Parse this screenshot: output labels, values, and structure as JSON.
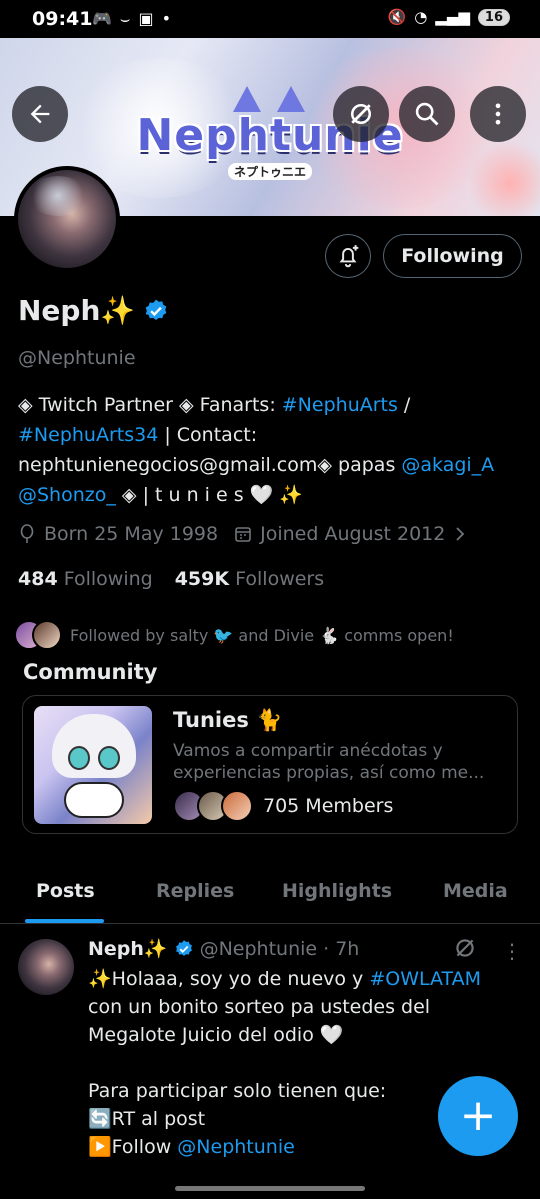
{
  "status_bar": {
    "time": "09:41",
    "battery": "16"
  },
  "banner": {
    "logo_text": "Nephtunie",
    "logo_subtext": "ネプトゥニエ"
  },
  "profile": {
    "name": "Neph✨",
    "handle": "@Nephtunie",
    "following_button": "Following",
    "bio": {
      "p1": "◈ Twitch Partner ◈ Fanarts: ",
      "tag1": "#NephuArts",
      "p2": " /",
      "tag2": "#NephuArts34",
      "p3": " | Contact: nephtunienegocios@gmail.com◈ papas ",
      "mention1": "@akagi_A",
      "p4": " ",
      "mention2": "@Shonzo_",
      "p5": " ◈ | t u n i e s 🤍 ✨"
    },
    "born": "Born 25 May 1998",
    "joined": "Joined August 2012",
    "following_count": "484",
    "following_label": "Following",
    "followers_count": "459K",
    "followers_label": "Followers",
    "followed_by": "Followed by salty 🐦 and Divie 🐇 comms open!"
  },
  "community": {
    "section_title": "Community",
    "name": "Tunies 🐈",
    "description": "Vamos a compartir anécdotas y experiencias propias, así como me...",
    "members": "705 Members"
  },
  "tabs": [
    "Posts",
    "Replies",
    "Highlights",
    "Media"
  ],
  "post": {
    "name": "Neph✨",
    "handle_time": "@Nephtunie · 7h",
    "line1_a": "✨Holaaa, soy yo de nuevo y ",
    "line1_tag": "#OWLATAM",
    "line1_b": " con un bonito sorteo pa ustedes del Megalote Juicio del odio 🤍",
    "line2": "Para participar solo tienen que:",
    "line3": "🔄RT al post",
    "line4_a": "▶️Follow ",
    "line4_mention": "@Nephtunie"
  },
  "fab_label": "+",
  "colors": {
    "accent": "#1d9bf0",
    "text": "#e7e9ea",
    "muted": "#71767b",
    "border": "#2f3336"
  }
}
